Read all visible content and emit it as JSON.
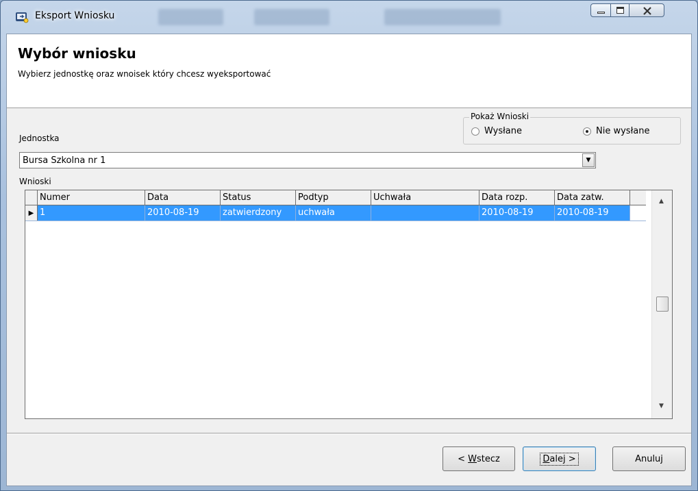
{
  "window": {
    "title": "Eksport Wniosku"
  },
  "header": {
    "title": "Wybór wniosku",
    "subtitle": "Wybierz jednostkę oraz wnoisek  który chcesz  wyeksportować"
  },
  "filter": {
    "group_label": "Pokaż Wnioski",
    "options": [
      {
        "label": "Wysłane",
        "selected": false
      },
      {
        "label": "Nie wysłane",
        "selected": true
      }
    ]
  },
  "unit": {
    "label": "Jednostka",
    "selected": "Bursa Szkolna nr 1"
  },
  "grid": {
    "label": "Wnioski",
    "columns": [
      "Numer",
      "Data",
      "Status",
      "Podtyp",
      "Uchwała",
      "Data rozp.",
      "Data zatw."
    ],
    "rows": [
      [
        "1",
        "2010-08-19",
        "zatwierdzony",
        "uchwała",
        "",
        "2010-08-19",
        "2010-08-19"
      ]
    ]
  },
  "buttons": {
    "back": {
      "prefix": "< ",
      "mnemonic": "W",
      "rest": "stecz"
    },
    "next": {
      "mnemonic": "D",
      "rest": "alej >"
    },
    "cancel": "Anuluj"
  }
}
